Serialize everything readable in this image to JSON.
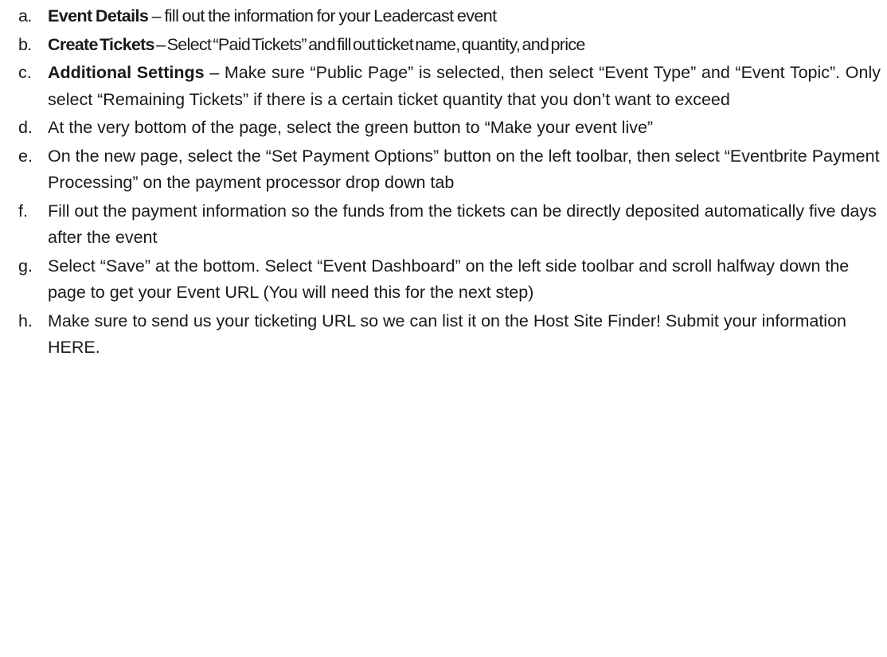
{
  "items": [
    {
      "marker": "a.",
      "heading": "Event Details",
      "separator": " – ",
      "text": "fill out the information for your Leadercast event"
    },
    {
      "marker": "b.",
      "heading": "Create Tickets",
      "separator": " – ",
      "text": "Select “Paid Tickets” and fill out ticket name, quantity, and price"
    },
    {
      "marker": "c.",
      "heading": "Additional Settings",
      "separator": " – ",
      "text": "Make sure “Public Page” is selected, then select “Event Type” and “Event Topic”. Only select “Remaining Tickets” if there is a certain ticket quantity that you don’t want to exceed"
    },
    {
      "marker": "d.",
      "text": "At the very bottom of the page, select the green button to “Make your event live”"
    },
    {
      "marker": "e.",
      "text": "On the new page, select the “Set Payment Options” button on the left toolbar, then select “Eventbrite Payment Processing” on the payment processor drop down tab"
    },
    {
      "marker": "f.",
      "text": "Fill out the payment information so the funds from the tickets can be directly deposited automatically five days after the event"
    },
    {
      "marker": "g.",
      "text": "Select “Save” at the bottom. Select “Event Dashboard” on the left side toolbar and scroll halfway down the page to get your Event URL (You will need this for the next step)"
    },
    {
      "marker": "h.",
      "text": "Make sure to send us your ticketing URL so we can list it on the Host Site Finder! Submit your information HERE."
    }
  ]
}
